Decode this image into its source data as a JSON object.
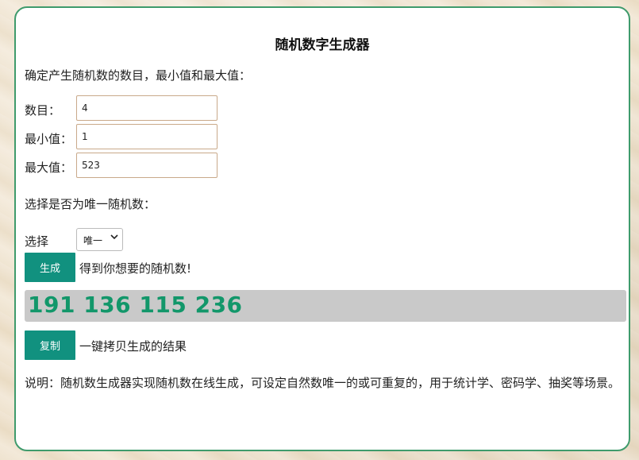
{
  "page": {
    "title": "随机数字生成器",
    "intro": "确定产生随机数的数目，最小值和最大值："
  },
  "fields": {
    "count_label": "数目：",
    "count_value": "4",
    "min_label": "最小值：",
    "min_value": "1",
    "max_label": "最大值：",
    "max_value": "523"
  },
  "unique": {
    "prompt": "选择是否为唯一随机数：",
    "select_label": "选择",
    "select_value": "唯一"
  },
  "generate": {
    "button_label": "生成",
    "hint": "得到你想要的随机数!"
  },
  "result": {
    "numbers": "191 136 115 236"
  },
  "copy": {
    "button_label": "复制",
    "hint": "一键拷贝生成的结果"
  },
  "description": "说明：随机数生成器实现随机数在线生成，可设定自然数唯一的或可重复的，用于统计学、密码学、抽奖等场景。",
  "colors": {
    "accent_button": "#11917f",
    "result_text": "#12976a",
    "card_border": "#3f9b6c"
  },
  "icons": {
    "select_arrow": "chevron-down-icon"
  }
}
